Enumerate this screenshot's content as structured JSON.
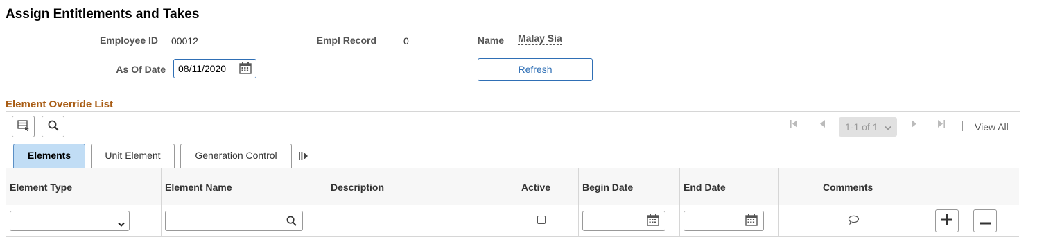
{
  "page": {
    "title": "Assign Entitlements and Takes"
  },
  "header": {
    "employee_id_label": "Employee ID",
    "employee_id": "00012",
    "empl_record_label": "Empl Record",
    "empl_record": "0",
    "name_label": "Name",
    "name": "Malay Sia",
    "as_of_date_label": "As Of Date",
    "as_of_date": "08/11/2020",
    "refresh_label": "Refresh"
  },
  "grid": {
    "title": "Element Override List",
    "pager": "1-1 of 1",
    "view_all": "View All",
    "tabs": [
      {
        "label": "Elements",
        "active": true
      },
      {
        "label": "Unit Element",
        "active": false
      },
      {
        "label": "Generation Control",
        "active": false
      }
    ],
    "columns": [
      "Element Type",
      "Element Name",
      "Description",
      "Active",
      "Begin Date",
      "End Date",
      "Comments"
    ],
    "rows": [
      {
        "element_type": "",
        "element_name": "",
        "description": "",
        "active": false,
        "begin_date": "",
        "end_date": ""
      }
    ]
  },
  "colors": {
    "accent": "#2f6fb5",
    "section_title": "#a85c14",
    "active_tab": "#c1ddf5"
  },
  "icons": [
    "calendar-icon",
    "search-icon",
    "personalize-grid-icon",
    "first-page-icon",
    "previous-page-icon",
    "next-page-icon",
    "last-page-icon",
    "chevron-down-icon",
    "show-all-columns-icon",
    "comment-icon",
    "add-row-icon",
    "delete-row-icon"
  ]
}
